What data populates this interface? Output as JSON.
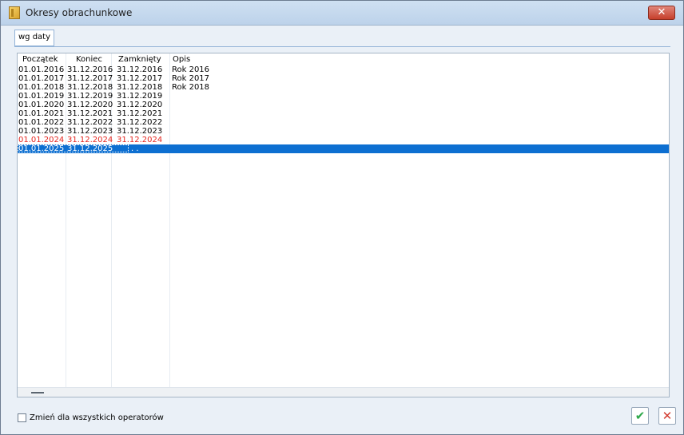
{
  "window": {
    "title": "Okresy obrachunkowe",
    "close_symbol": "✕",
    "close_icon": "close-icon",
    "app_icon": "folder-icon"
  },
  "tabs": [
    {
      "label": "wg daty",
      "active": true
    }
  ],
  "table": {
    "columns": [
      "Początek",
      "Koniec",
      "Zamknięty",
      "Opis"
    ],
    "rows": [
      {
        "start": "01.01.2016",
        "end": "31.12.2016",
        "closed": "31.12.2016",
        "desc": "Rok 2016",
        "state": "normal"
      },
      {
        "start": "01.01.2017",
        "end": "31.12.2017",
        "closed": "31.12.2017",
        "desc": "Rok 2017",
        "state": "normal"
      },
      {
        "start": "01.01.2018",
        "end": "31.12.2018",
        "closed": "31.12.2018",
        "desc": "Rok 2018",
        "state": "normal"
      },
      {
        "start": "01.01.2019",
        "end": "31.12.2019",
        "closed": "31.12.2019",
        "desc": "",
        "state": "normal"
      },
      {
        "start": "01.01.2020",
        "end": "31.12.2020",
        "closed": "31.12.2020",
        "desc": "",
        "state": "normal"
      },
      {
        "start": "01.01.2021",
        "end": "31.12.2021",
        "closed": "31.12.2021",
        "desc": "",
        "state": "normal"
      },
      {
        "start": "01.01.2022",
        "end": "31.12.2022",
        "closed": "31.12.2022",
        "desc": "",
        "state": "normal"
      },
      {
        "start": "01.01.2023",
        "end": "31.12.2023",
        "closed": "31.12.2023",
        "desc": "",
        "state": "normal"
      },
      {
        "start": "01.01.2024",
        "end": "31.12.2024",
        "closed": "31.12.2024",
        "desc": "",
        "state": "red"
      },
      {
        "start": "01.01.2025",
        "end": "31.12.2025",
        "closed": " .  .",
        "desc": "",
        "state": "selected"
      }
    ]
  },
  "footer": {
    "checkbox_label": "Zmień dla wszystkich operatorów",
    "checkbox_checked": false,
    "ok_symbol": "✔",
    "cancel_symbol": "✕",
    "ok_icon": "check-icon",
    "cancel_icon": "cancel-icon"
  },
  "colors": {
    "selection": "#0d6fd1",
    "red_row": "#e5251f",
    "ok": "#2ea84a",
    "cancel": "#d23b2f"
  }
}
